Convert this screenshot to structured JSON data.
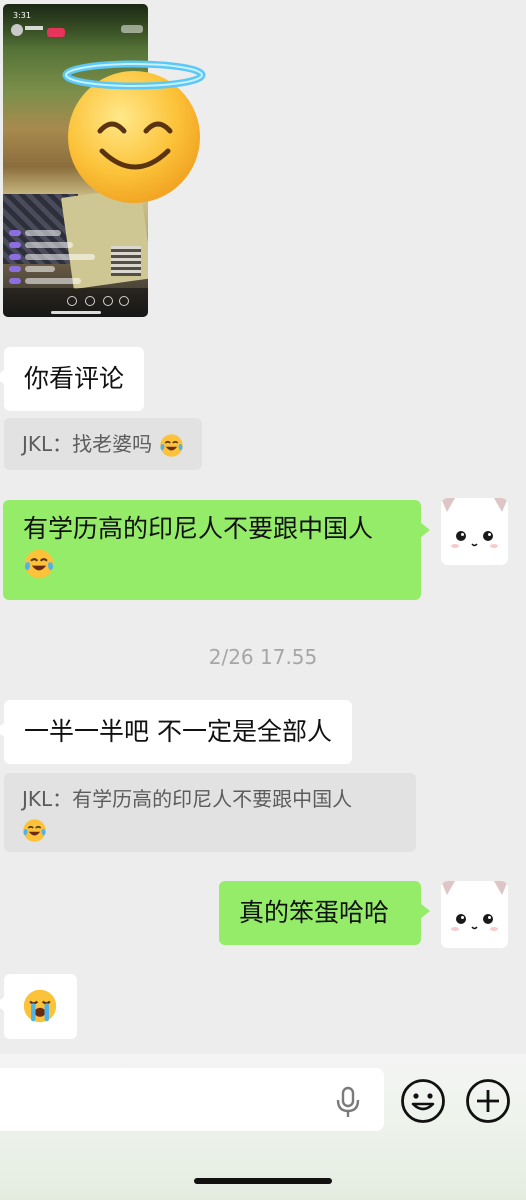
{
  "chat": {
    "messages": [
      {
        "kind": "image",
        "sender": "other"
      },
      {
        "kind": "text",
        "sender": "other",
        "text": "你看评论"
      },
      {
        "kind": "quote",
        "sender": "other",
        "text": "JKL：找老婆吗",
        "emoji": "face-with-tears-of-joy"
      },
      {
        "kind": "text",
        "sender": "me",
        "text": "有学历高的印尼人不要跟中国人",
        "emoji": "face-with-tears-of-joy"
      },
      {
        "kind": "timestamp",
        "text": "2/26 17.55"
      },
      {
        "kind": "text",
        "sender": "other",
        "text": "一半一半吧 不一定是全部人"
      },
      {
        "kind": "quote",
        "sender": "other",
        "text": "JKL：有学历高的印尼人不要跟中国人",
        "emoji": "face-with-tears-of-joy"
      },
      {
        "kind": "text",
        "sender": "me",
        "text": "真的笨蛋哈哈"
      },
      {
        "kind": "emoji",
        "sender": "other",
        "emoji": "loudly-crying-face"
      }
    ]
  },
  "media": {
    "time": "3:31",
    "sticker": "smiling-face-with-halo"
  },
  "input_bar": {
    "icons": [
      "microphone-icon",
      "emoji-face-icon",
      "add-circle-icon"
    ]
  },
  "colors": {
    "chat_background": "#ededed",
    "bubble_me": "#95ec69",
    "bubble_other": "#ffffff",
    "quote_background": "#e2e2e2",
    "timestamp_text": "#a6a6a6"
  }
}
